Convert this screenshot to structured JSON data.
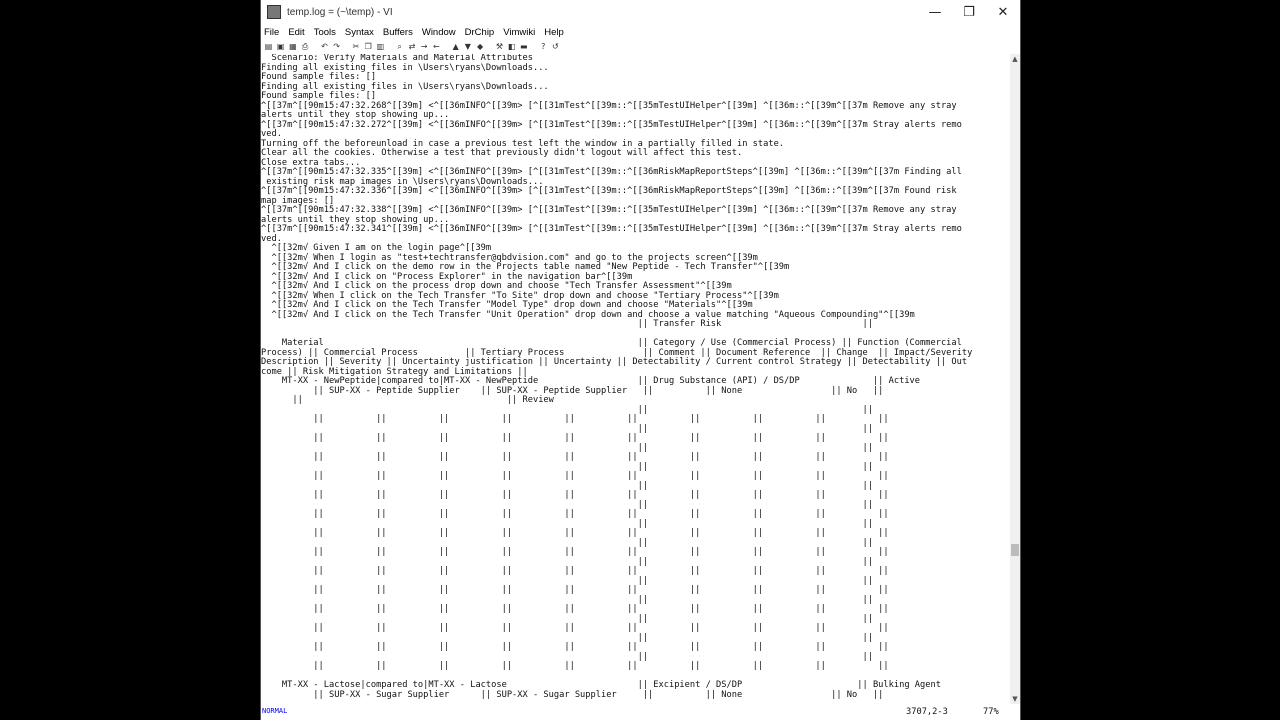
{
  "window": {
    "title": "temp.log = (~\\temp) - VI"
  },
  "window_controls": {
    "minimize": "—",
    "maximize": "❐",
    "close": "✕"
  },
  "menu": [
    "File",
    "Edit",
    "Tools",
    "Syntax",
    "Buffers",
    "Window",
    "DrChip",
    "Vimwiki",
    "Help"
  ],
  "toolbar_icons": [
    "open-icon",
    "save-icon",
    "save-all-icon",
    "print-icon",
    "undo-icon",
    "redo-icon",
    "cut-icon",
    "copy-icon",
    "paste-icon",
    "find-icon",
    "replace-icon",
    "find-next-icon",
    "find-prev-icon",
    "load-session-icon",
    "save-session-icon",
    "run-script-icon",
    "make-icon",
    "run-ctags-icon",
    "jump-tag-icon",
    "help-icon",
    "find-help-icon"
  ],
  "editor_lines": [
    "  Scenario: Verify Materials and Material Attributes",
    "Finding all existing files in \\Users\\ryans\\Downloads...",
    "Found sample files: []",
    "Finding all existing files in \\Users\\ryans\\Downloads...",
    "Found sample files: []",
    "^[[37m^[[90m15:47:32.268^[[39m] <^[[36mINFO^[[39m> [^[[31mTest^[[39m::^[[35mTestUIHelper^[[39m] ^[[36m::^[[39m^[[37m Remove any stray",
    "alerts until they stop showing up...",
    "^[[37m^[[90m15:47:32.272^[[39m] <^[[36mINFO^[[39m> [^[[31mTest^[[39m::^[[35mTestUIHelper^[[39m] ^[[36m::^[[39m^[[37m Stray alerts remo",
    "ved.",
    "Turning off the beforeunload in case a previous test left the window in a partially filled in state.",
    "Clear all the cookies. Otherwise a test that previously didn't logout will affect this test.",
    "Close extra tabs...",
    "^[[37m^[[90m15:47:32.335^[[39m] <^[[36mINFO^[[39m> [^[[31mTest^[[39m::^[[36mRiskMapReportSteps^[[39m] ^[[36m::^[[39m^[[37m Finding all",
    " existing risk map images in \\Users\\ryans\\Downloads...",
    "^[[37m^[[90m15:47:32.336^[[39m] <^[[36mINFO^[[39m> [^[[31mTest^[[39m::^[[36mRiskMapReportSteps^[[39m] ^[[36m::^[[39m^[[37m Found risk",
    "map images: []",
    "^[[37m^[[90m15:47:32.338^[[39m] <^[[36mINFO^[[39m> [^[[31mTest^[[39m::^[[35mTestUIHelper^[[39m] ^[[36m::^[[39m^[[37m Remove any stray",
    "alerts until they stop showing up...",
    "^[[37m^[[90m15:47:32.341^[[39m] <^[[36mINFO^[[39m> [^[[31mTest^[[39m::^[[35mTestUIHelper^[[39m] ^[[36m::^[[39m^[[37m Stray alerts remo",
    "ved.",
    "  ^[[32m√ Given I am on the login page^[[39m",
    "  ^[[32m√ When I login as \"test+techtransfer@qbdvision.com\" and go to the projects screen^[[39m",
    "  ^[[32m√ And I click on the demo row in the Projects table named \"New Peptide - Tech Transfer\"^[[39m",
    "  ^[[32m√ And I click on \"Process Explorer\" in the navigation bar^[[39m",
    "  ^[[32m√ And I click on the process drop down and choose \"Tech Transfer Assessment\"^[[39m",
    "  ^[[32m√ When I click on the Tech Transfer \"To Site\" drop down and choose \"Tertiary Process\"^[[39m",
    "  ^[[32m√ And I click on the Tech Transfer \"Model Type\" drop down and choose \"Materials\"^[[39m",
    "  ^[[32m√ And I click on the Tech Transfer \"Unit Operation\" drop down and choose a value matching \"Aqueous Compounding\"^[[39m",
    "                                                                        || Transfer Risk                           ||",
    "",
    "    Material                                                            || Category / Use (Commercial Process) || Function (Commercial",
    "Process) || Commercial Process         || Tertiary Process               || Comment || Document Reference  || Change  || Impact/Severity",
    "Description || Severity || Uncertainty justification || Uncertainty || Detectability / Current control Strategy || Detectability || Out",
    "come || Risk Mitigation Strategy and Limitations ||",
    "    MT-XX - NewPeptide|compared to|MT-XX - NewPeptide                   || Drug Substance (API) / DS/DP              || Active",
    "          || SUP-XX - Peptide Supplier    || SUP-XX - Peptide Supplier   ||          || None                 || No   ||",
    "      ||                                       || Review",
    "                                                                        ||                                         ||",
    "          ||          ||          ||          ||          ||          ||          ||          ||          ||          ||",
    "                                                                        ||                                         ||",
    "          ||          ||          ||          ||          ||          ||          ||          ||          ||          ||",
    "                                                                        ||                                         ||",
    "          ||          ||          ||          ||          ||          ||          ||          ||          ||          ||",
    "                                                                        ||                                         ||",
    "          ||          ||          ||          ||          ||          ||          ||          ||          ||          ||",
    "                                                                        ||                                         ||",
    "          ||          ||          ||          ||          ||          ||          ||          ||          ||          ||",
    "                                                                        ||                                         ||",
    "          ||          ||          ||          ||          ||          ||          ||          ||          ||          ||",
    "                                                                        ||                                         ||",
    "          ||          ||          ||          ||          ||          ||          ||          ||          ||          ||",
    "                                                                        ||                                         ||",
    "          ||          ||          ||          ||          ||          ||          ||          ||          ||          ||",
    "                                                                        ||                                         ||",
    "          ||          ||          ||          ||          ||          ||          ||          ||          ||          ||",
    "                                                                        ||                                         ||",
    "          ||          ||          ||          ||          ||          ||          ||          ||          ||          ||",
    "                                                                        ||                                         ||",
    "          ||          ||          ||          ||          ||          ||          ||          ||          ||          ||",
    "                                                                        ||                                         ||",
    "          ||          ||          ||          ||          ||          ||          ||          ||          ||          ||",
    "                                                                        ||                                         ||",
    "          ||          ||          ||          ||          ||          ||          ||          ||          ||          ||",
    "                                                                        ||                                         ||",
    "          ||          ||          ||          ||          ||          ||          ||          ||          ||          ||",
    "",
    "    MT-XX - Lactose|compared to|MT-XX - Lactose                         || Excipient / DS/DP                      || Bulking Agent",
    "          || SUP-XX - Sugar Supplier      || SUP-XX - Sugar Supplier     ||          || None                 || No   ||"
  ],
  "status": {
    "mode": "NORMAL",
    "position": "3707,2-3",
    "percent": "77%"
  }
}
